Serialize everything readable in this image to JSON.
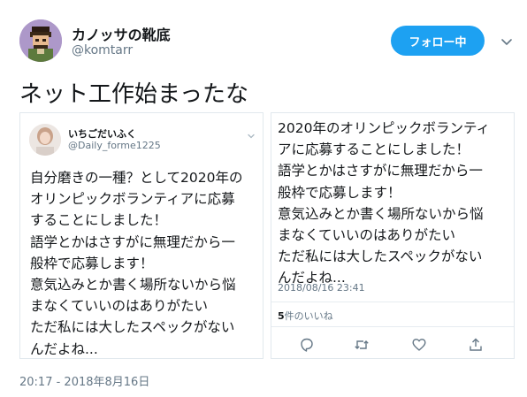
{
  "author": {
    "name": "カノッサの靴底",
    "handle": "@komtarr"
  },
  "follow_button_label": "フォロー中",
  "tweet_text": "ネット工作始まったな",
  "quoted_left": {
    "name": "いちごだいふく",
    "handle": "@Daily_forme1225",
    "body_lines": [
      "自分磨きの一種？として2020年の",
      "オリンピックボランティアに応募",
      "することにしました！",
      "語学とかはさすがに無理だから一",
      "般枠で応募します！",
      "意気込みとか書く場所ないから悩",
      "まなくていいのはありがたい",
      "ただ私には大したスペックがない",
      "んだよね..."
    ]
  },
  "quoted_right": {
    "body_lines": [
      "2020年のオリンピックボランティ",
      "アに応募することにしました！",
      "語学とかはさすがに無理だから一",
      "般枠で応募します！",
      "意気込みとか書く場所ないから悩",
      "まなくていいのはありがたい",
      "ただ私には大したスペックがない",
      "んだよね..."
    ],
    "timestamp": "2018/08/16 23:41",
    "likes_count": "5",
    "likes_label": "件のいいね",
    "actions": [
      "reply-icon",
      "retweet-icon",
      "like-icon",
      "share-icon"
    ]
  },
  "timestamp": "20:17 - 2018年8月16日",
  "colors": {
    "accent": "#1da1f2",
    "text": "#14171a",
    "secondary": "#657786",
    "border": "#e1e8ed"
  }
}
